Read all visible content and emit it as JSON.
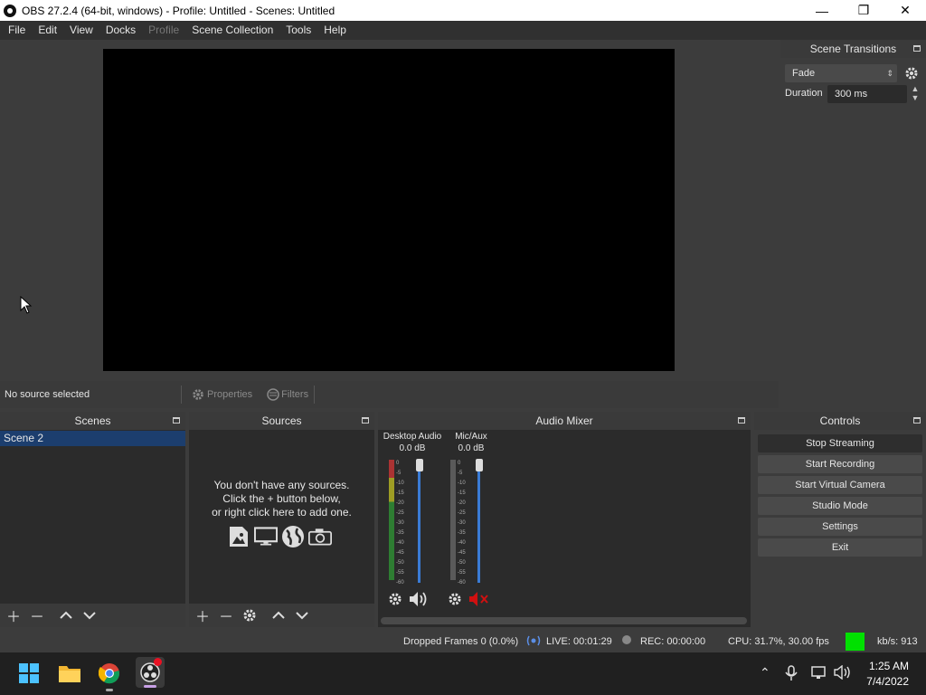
{
  "window": {
    "title": "OBS 27.2.4 (64-bit, windows) - Profile: Untitled - Scenes: Untitled",
    "minimize": "—",
    "maximize": "❐",
    "close": "✕"
  },
  "menu": [
    "File",
    "Edit",
    "View",
    "Docks",
    "Profile",
    "Scene Collection",
    "Tools",
    "Help"
  ],
  "menu_disabled": [
    "Profile"
  ],
  "transitions": {
    "header": "Scene Transitions",
    "selected": "Fade",
    "duration_label": "Duration",
    "duration_value": "300 ms"
  },
  "propbar": {
    "no_source": "No source selected",
    "properties": "Properties",
    "filters": "Filters"
  },
  "scenes": {
    "header": "Scenes",
    "items": [
      "Scene 2"
    ]
  },
  "sources": {
    "header": "Sources",
    "empty_line1": "You don't have any sources.",
    "empty_line2": "Click the + button below,",
    "empty_line3": "or right click here to add one."
  },
  "mixer": {
    "header": "Audio Mixer",
    "channels": [
      {
        "name": "Desktop Audio",
        "db": "0.0 dB",
        "muted": false
      },
      {
        "name": "Mic/Aux",
        "db": "0.0 dB",
        "muted": true
      }
    ],
    "scale": [
      "0",
      "-5",
      "-10",
      "-15",
      "-20",
      "-25",
      "-30",
      "-35",
      "-40",
      "-45",
      "-50",
      "-55",
      "-60"
    ]
  },
  "controls": {
    "header": "Controls",
    "buttons": [
      "Stop Streaming",
      "Start Recording",
      "Start Virtual Camera",
      "Studio Mode",
      "Settings",
      "Exit"
    ]
  },
  "status": {
    "dropped": "Dropped Frames 0 (0.0%)",
    "live": "LIVE: 00:01:29",
    "rec": "REC: 00:00:00",
    "cpu": "CPU: 31.7%, 30.00 fps",
    "kbs": "kb/s: 913",
    "indicator_color": "#00e000"
  },
  "taskbar": {
    "time": "1:25 AM",
    "date": "7/4/2022"
  },
  "colors": {
    "accent": "#3a7bd5",
    "selection": "#1c3e6e",
    "mute_red": "#d01010"
  }
}
